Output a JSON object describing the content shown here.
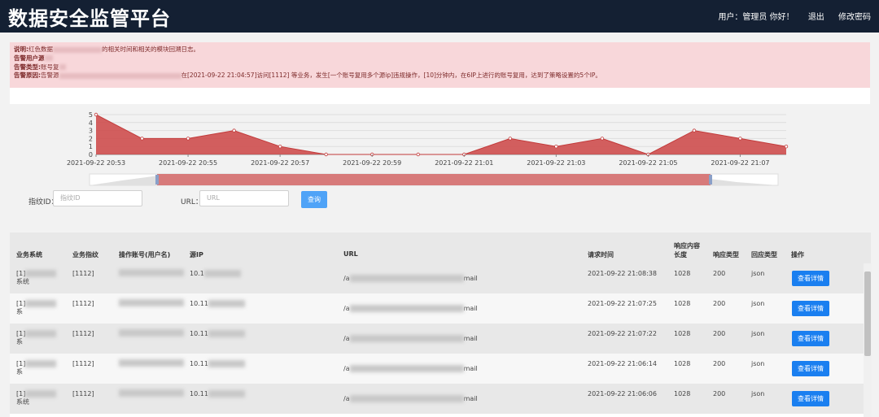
{
  "header": {
    "title": "数据安全监管平台",
    "user_greeting": "用户：管理员 你好！",
    "logout_label": "退出",
    "change_password_label": "修改密码"
  },
  "alert": {
    "line1_prefix": "说明:",
    "line1_text": "红色数据",
    "line1_suffix": "的相关时间和相关的模块回溯日志。",
    "line2_label": "告警用户源",
    "line3_label": "告警类型:",
    "line3_text": "账号复",
    "line4_label": "告警原因:",
    "line4_text": "告警源",
    "line4_detail": "在[2021-09-22 21:04:57]访问[1112] 等业务，发生[一个账号复用多个源ip]违规操作，[10]分钟内，在6IP上进行的账号复用，达到了策略设置的5个IP。"
  },
  "chart_data": {
    "type": "area",
    "x": [
      "20:53",
      "20:54",
      "20:55",
      "20:56",
      "20:57",
      "20:58",
      "20:59",
      "21:00",
      "21:01",
      "21:02",
      "21:03",
      "21:04",
      "21:05",
      "21:06",
      "21:07",
      "21:08"
    ],
    "values": [
      5,
      2,
      2,
      3,
      1,
      0,
      0,
      0,
      0,
      2,
      1,
      2,
      0,
      3,
      2,
      1
    ],
    "x_tick_labels": [
      "2021-09-22 20:53",
      "2021-09-22 20:55",
      "2021-09-22 20:57",
      "2021-09-22 20:59",
      "2021-09-22 21:01",
      "2021-09-22 21:03",
      "2021-09-22 21:05",
      "2021-09-22 21:07"
    ],
    "y_ticks": [
      0,
      1,
      2,
      3,
      4,
      5
    ],
    "ylim": [
      0,
      5
    ],
    "color": "#cc4444",
    "grid": true
  },
  "filters": {
    "fingerprint_label": "指纹ID：",
    "fingerprint_placeholder": "指纹ID",
    "url_label": "URL：",
    "url_placeholder": "URL",
    "query_label": "查询"
  },
  "table": {
    "headers": [
      "业务系统",
      "业务指纹",
      "操作账号(用户名)",
      "源IP",
      "URL",
      "请求时间",
      "响应内容长度",
      "响应类型",
      "回应类型",
      "操作"
    ],
    "header_len_line1": "响应内容",
    "header_len_line2": "长度",
    "detail_label": "查看详情",
    "rows": [
      {
        "sys_prefix": "[1]",
        "sys_suffix": "系统",
        "fp": "[1112]",
        "ip": "10.1",
        "url_prefix": "/a",
        "url_suffix": "mail",
        "time": "2021-09-22 21:08:38",
        "len": "1028",
        "resp": "200",
        "type": "json"
      },
      {
        "sys_prefix": "[1]",
        "sys_suffix": "系",
        "fp": "[1112]",
        "ip": "10.11",
        "url_prefix": "/a",
        "url_suffix": "mail",
        "time": "2021-09-22 21:07:25",
        "len": "1028",
        "resp": "200",
        "type": "json"
      },
      {
        "sys_prefix": "[1]",
        "sys_suffix": "系",
        "fp": "[1112]",
        "ip": "10.11",
        "url_prefix": "/a",
        "url_suffix": "mail",
        "time": "2021-09-22 21:07:22",
        "len": "1028",
        "resp": "200",
        "type": "json"
      },
      {
        "sys_prefix": "[1]",
        "sys_suffix": "系",
        "fp": "[1112]",
        "ip": "10.11",
        "url_prefix": "/a",
        "url_suffix": "mail",
        "time": "2021-09-22 21:06:14",
        "len": "1028",
        "resp": "200",
        "type": "json"
      },
      {
        "sys_prefix": "[1]",
        "sys_suffix": "系统",
        "fp": "[1112]",
        "ip": "10.11",
        "url_prefix": "/a",
        "url_suffix": "mail",
        "time": "2021-09-22 21:06:06",
        "len": "1028",
        "resp": "200",
        "type": "json"
      }
    ]
  }
}
